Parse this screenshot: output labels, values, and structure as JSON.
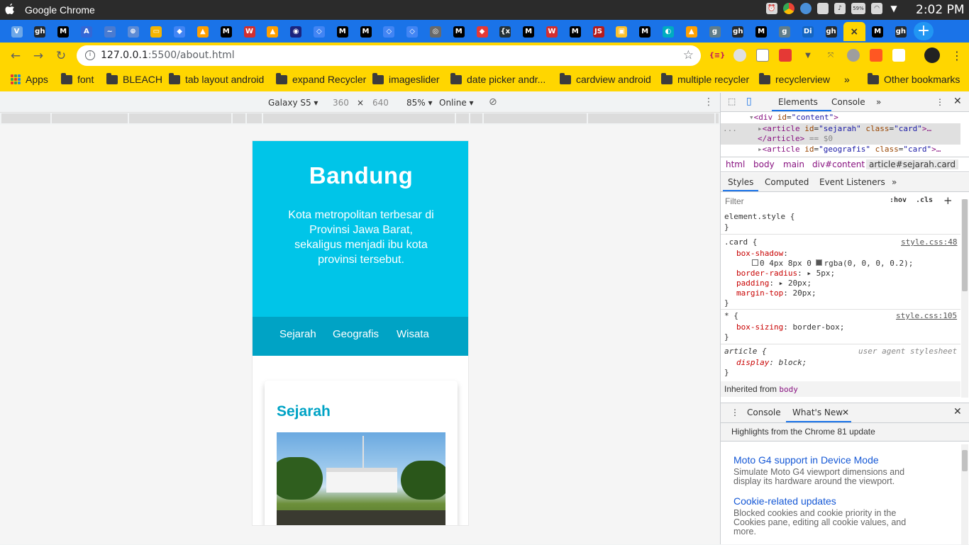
{
  "os": {
    "app_name": "Google Chrome",
    "clock": "2:02 PM",
    "battery": "59%"
  },
  "browser": {
    "tabs": [
      {
        "icon": "V"
      },
      {
        "icon": "gh"
      },
      {
        "icon": "M"
      },
      {
        "icon": "A"
      },
      {
        "icon": "~"
      },
      {
        "icon": "⊕"
      },
      {
        "icon": "▭"
      },
      {
        "icon": "◆"
      },
      {
        "icon": "▲"
      },
      {
        "icon": "M"
      },
      {
        "icon": "W"
      },
      {
        "icon": "▲"
      },
      {
        "icon": "◉"
      },
      {
        "icon": "◇"
      },
      {
        "icon": "M"
      },
      {
        "icon": "M"
      },
      {
        "icon": "◇"
      },
      {
        "icon": "◇"
      },
      {
        "icon": "◎"
      },
      {
        "icon": "M"
      },
      {
        "icon": "◆"
      },
      {
        "icon": "{x}"
      },
      {
        "icon": "M"
      },
      {
        "icon": "W"
      },
      {
        "icon": "M"
      },
      {
        "icon": "JSON"
      },
      {
        "icon": "▣"
      },
      {
        "icon": "M"
      },
      {
        "icon": "◐"
      },
      {
        "icon": "▲"
      },
      {
        "icon": "g"
      },
      {
        "icon": "gh"
      },
      {
        "icon": "M"
      },
      {
        "icon": "g"
      },
      {
        "icon": "Di"
      },
      {
        "icon": "gh"
      },
      {
        "icon": "×"
      },
      {
        "icon": "M"
      },
      {
        "icon": "gh"
      }
    ],
    "url_host": "127.0.0.1",
    "url_path": ":5500/about.html",
    "bookmarks": [
      {
        "label": "Apps"
      },
      {
        "label": "font"
      },
      {
        "label": "BLEACH"
      },
      {
        "label": "tab layout android"
      },
      {
        "label": "expand Recycler"
      },
      {
        "label": "imageslider"
      },
      {
        "label": "date picker andr..."
      },
      {
        "label": "cardview android"
      },
      {
        "label": "multiple recycler"
      },
      {
        "label": "recyclerview"
      }
    ],
    "more_bookmarks": "»",
    "other_bookmarks": "Other bookmarks"
  },
  "device_toolbar": {
    "device": "Galaxy S5",
    "width": "360",
    "times": "×",
    "height": "640",
    "zoom": "85%",
    "network": "Online"
  },
  "page": {
    "title": "Bandung",
    "subtitle": "Kota metropolitan terbesar di Provinsi Jawa Barat, sekaligus menjadi ibu kota provinsi tersebut.",
    "nav": [
      "Sejarah",
      "Geografis",
      "Wisata"
    ],
    "card_title": "Sejarah"
  },
  "devtools": {
    "tabs": [
      "Elements",
      "Console",
      "»"
    ],
    "dom": {
      "line1_tag": "<div",
      "line1_attr": "id",
      "line1_val": "\"content\"",
      "line1_end": ">",
      "line2_tag": "<article",
      "line2_attr1": "id",
      "line2_val1": "\"sejarah\"",
      "line2_attr2": "class",
      "line2_val2": "\"card\"",
      "line2_end": ">…",
      "line3_tag": "</article>",
      "line3_eq": "== $0",
      "line4_tag": "<article",
      "line4_attr1": "id",
      "line4_val1": "\"geografis\"",
      "line4_attr2": "class",
      "line4_val2": "\"card\"",
      "line4_end": ">…",
      "ellipsis": "..."
    },
    "breadcrumbs": [
      "html",
      "body",
      "main",
      "div#content",
      "article#sejarah.card"
    ],
    "sub_tabs": [
      "Styles",
      "Computed",
      "Event Listeners",
      "»"
    ],
    "filter_placeholder": "Filter",
    "hov": ":hov",
    "cls": ".cls",
    "plus": "+",
    "styles": {
      "element_style": "element.style {",
      "close": "}",
      "card_selector": ".card {",
      "card_src": "style.css:48",
      "box_shadow_prop": "box-shadow",
      "box_shadow_val": "0 4px 8px 0",
      "box_shadow_color": "rgba(0, 0, 0, 0.2);",
      "border_radius_prop": "border-radius",
      "border_radius_val": "5px;",
      "padding_prop": "padding",
      "padding_val": "20px;",
      "margin_top_prop": "margin-top",
      "margin_top_val": "20px;",
      "star_selector": "* {",
      "star_src": "style.css:105",
      "box_sizing_prop": "box-sizing",
      "box_sizing_val": "border-box;",
      "article_selector": "article {",
      "article_src": "user agent stylesheet",
      "display_prop": "display",
      "display_val": "block;",
      "inherited_label": "Inherited from",
      "inherited_el": "body"
    },
    "drawer": {
      "tabs": [
        "Console",
        "What's New"
      ],
      "highlights": "Highlights from the Chrome 81 update",
      "items": [
        {
          "title": "Moto G4 support in Device Mode",
          "desc": "Simulate Moto G4 viewport dimensions and display its hardware around the viewport."
        },
        {
          "title": "Cookie-related updates",
          "desc": "Blocked cookies and cookie priority in the Cookies pane, editing all cookie values, and more."
        }
      ]
    }
  },
  "colors": {
    "hero": "#00c5e8",
    "nav": "#00a3c5",
    "chrome_theme": "#ffd600",
    "tabstrip": "#1a73e8"
  }
}
